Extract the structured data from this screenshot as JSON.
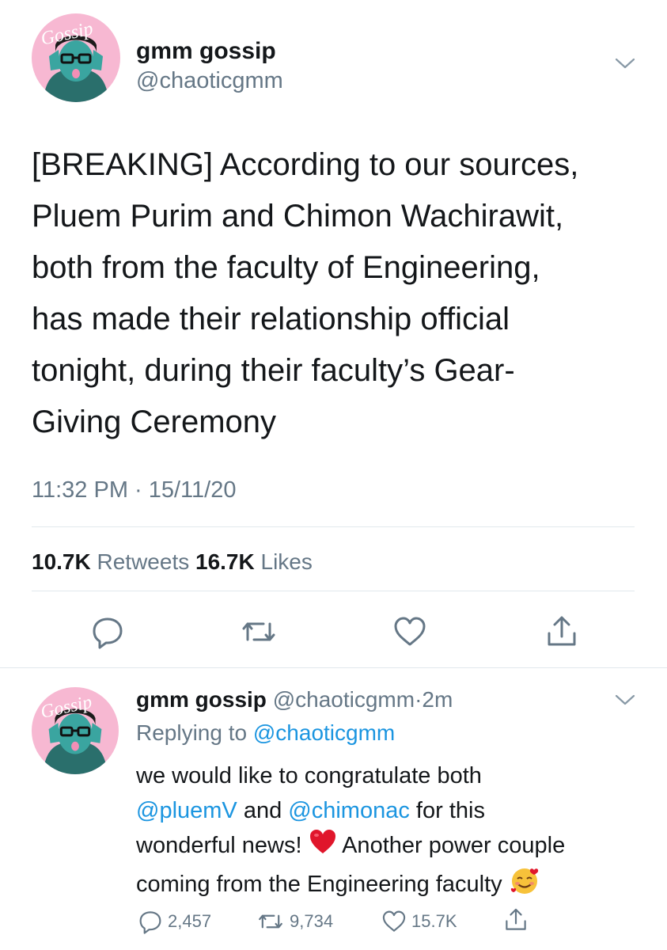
{
  "tweet": {
    "author_name": "gmm gossip",
    "author_handle": "@chaoticgmm",
    "avatar_text": "Gossip",
    "text_lines": [
      "[BREAKING] According to our sources,",
      "Pluem Purim and Chimon Wachirawit,",
      "both from the faculty of Engineering,",
      "has made their relationship official",
      "tonight, during their faculty’s Gear-",
      "Giving Ceremony"
    ],
    "timestamp": "11:32 PM · 15/11/20",
    "retweets_count": "10.7K",
    "retweets_label": "Retweets",
    "likes_count": "16.7K",
    "likes_label": "Likes"
  },
  "reply": {
    "author_name": "gmm gossip",
    "author_handle": "@chaoticgmm",
    "separator": "·",
    "time": "2m",
    "replying_prefix": "Replying to",
    "replying_handle": "@chaoticgmm",
    "avatar_text": "Gossip",
    "line1": "we would like to congratulate both",
    "mention1": "@pluemV",
    "and_text": "and",
    "mention2": "@chimonac",
    "line2_end": "for this",
    "line3_start": "wonderful news!",
    "line3_end": "Another power couple",
    "line4": "coming from the Engineering faculty",
    "reply_count": "2,457",
    "retweet_count": "9,734",
    "like_count": "15.7K"
  },
  "icons": {
    "reply": "reply-icon",
    "retweet": "retweet-icon",
    "like": "heart-icon",
    "share": "share-icon",
    "menu": "chevron-down-icon",
    "heart_emoji": "red-heart-emoji",
    "smile_emoji": "smiling-face-with-hearts-emoji"
  },
  "colors": {
    "text": "#14171a",
    "muted": "#657786",
    "link": "#1b95e0",
    "divider": "#e1e8ed",
    "avatar_bg": "#f7b8d2",
    "avatar_face": "#3aa5a0"
  }
}
